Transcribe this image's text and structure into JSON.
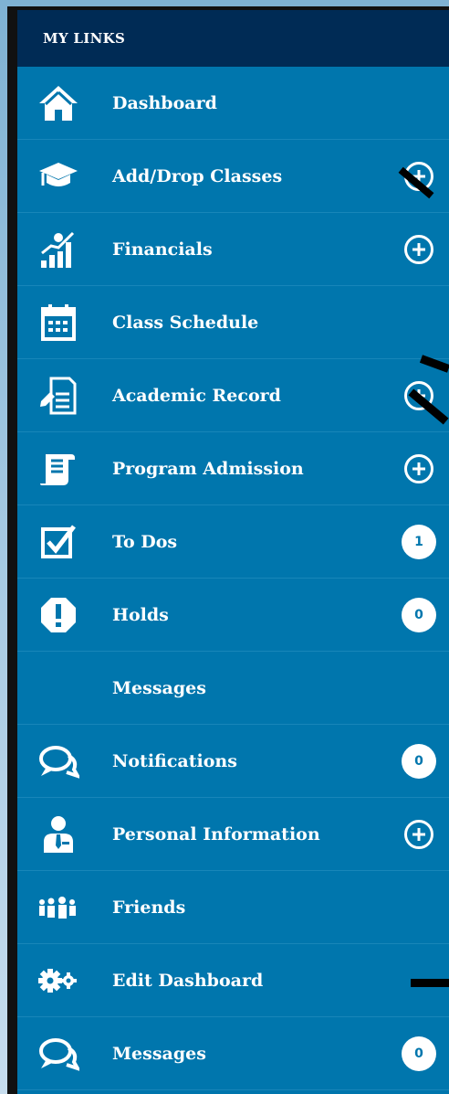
{
  "header": {
    "title": "MY LINKS"
  },
  "items": [
    {
      "label": "Dashboard",
      "icon": "home-icon"
    },
    {
      "label": "Add/Drop Classes",
      "icon": "graduation-cap-icon",
      "action": "expand"
    },
    {
      "label": "Financials",
      "icon": "financial-chart-icon",
      "action": "expand"
    },
    {
      "label": "Class Schedule",
      "icon": "calendar-icon"
    },
    {
      "label": "Academic Record",
      "icon": "document-edit-icon",
      "action": "expand"
    },
    {
      "label": "Program Admission",
      "icon": "scroll-icon",
      "action": "expand"
    },
    {
      "label": "To Dos",
      "icon": "checkbox-icon",
      "badge": "1"
    },
    {
      "label": "Holds",
      "icon": "alert-icon",
      "badge": "0"
    },
    {
      "label": "Messages",
      "icon": ""
    },
    {
      "label": "Notifications",
      "icon": "chat-bubbles-icon",
      "badge": "0"
    },
    {
      "label": "Personal Information",
      "icon": "person-icon",
      "action": "expand"
    },
    {
      "label": "Friends",
      "icon": "people-group-icon"
    },
    {
      "label": "Edit Dashboard",
      "icon": "gears-icon"
    },
    {
      "label": "Messages",
      "icon": "chat-bubbles-icon",
      "badge": "0"
    }
  ],
  "colors": {
    "panel": "#0076ad",
    "header": "#002b55",
    "badge_text": "#0076ad"
  }
}
